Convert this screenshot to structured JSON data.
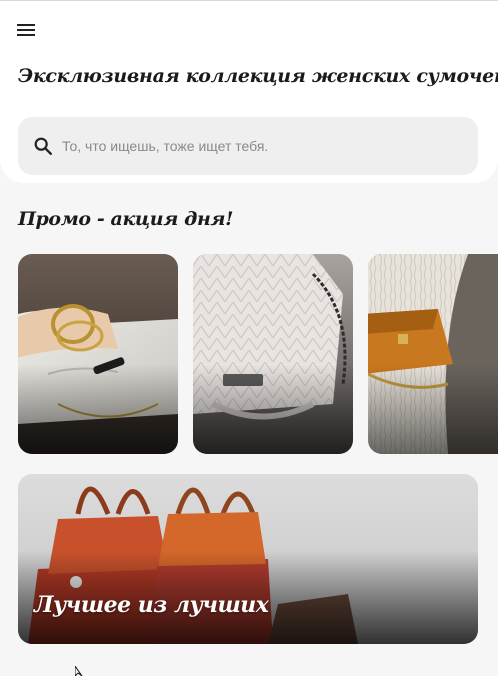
{
  "header": {
    "menu_icon": "hamburger-menu-icon",
    "title": "Эксклюзивная коллекция женских сумочек"
  },
  "search": {
    "icon": "search-icon",
    "placeholder": "То, что ищешь, тоже ищет тебя.",
    "value": ""
  },
  "promo": {
    "title": "Промо - акция дня!",
    "items": [
      {
        "image": "white-clutch-bag-with-gold-bracelets"
      },
      {
        "image": "white-quilted-chevron-bag-with-chain"
      },
      {
        "image": "orange-bag-with-white-knit-sweater"
      }
    ]
  },
  "featured": {
    "title": "Лучшее из лучших",
    "image": "red-and-orange-tote-bags"
  },
  "colors": {
    "background": "#f6f6f7",
    "card_background": "#ffffff",
    "search_background": "#efefef",
    "text": "#1b1b1b"
  }
}
